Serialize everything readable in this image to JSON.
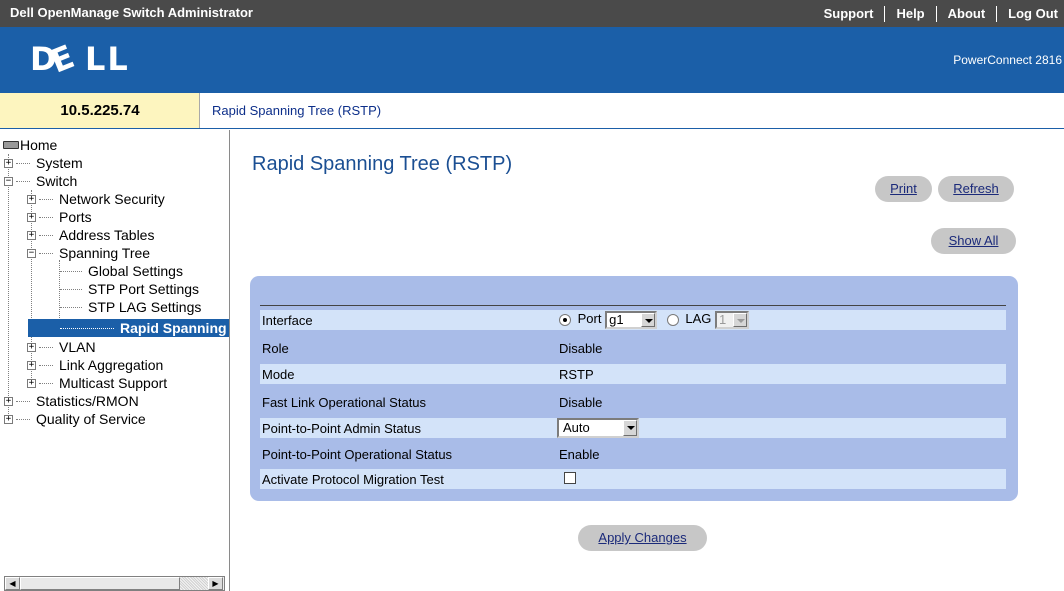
{
  "topbar": {
    "title": "Dell OpenManage Switch Administrator",
    "links": [
      "Support",
      "Help",
      "About",
      "Log Out"
    ]
  },
  "banner": {
    "logo": "DØLL",
    "model": "PowerConnect 2816"
  },
  "address": {
    "ip": "10.5.225.74",
    "breadcrumb": "Rapid Spanning Tree (RSTP)"
  },
  "tree": {
    "home": "Home",
    "system": "System",
    "switch": "Switch",
    "network_security": "Network Security",
    "ports": "Ports",
    "address_tables": "Address Tables",
    "spanning_tree": "Spanning Tree",
    "global_settings": "Global Settings",
    "stp_port_settings": "STP Port Settings",
    "stp_lag_settings": "STP LAG Settings",
    "rapid_spanning": "Rapid Spanning",
    "vlan": "VLAN",
    "link_aggregation": "Link Aggregation",
    "multicast_support": "Multicast Support",
    "statistics_rmon": "Statistics/RMON",
    "quality_of_service": "Quality of Service"
  },
  "main": {
    "title": "Rapid Spanning Tree (RSTP)",
    "print": "Print",
    "refresh": "Refresh",
    "show_all": "Show All",
    "apply": "Apply Changes"
  },
  "form": {
    "interface_label": "Interface",
    "port_label": "Port",
    "port_value": "g1",
    "lag_label": "LAG",
    "lag_value": "1",
    "role_label": "Role",
    "role_value": "Disable",
    "mode_label": "Mode",
    "mode_value": "RSTP",
    "fast_link_label": "Fast Link Operational Status",
    "fast_link_value": "Disable",
    "p2p_admin_label": "Point-to-Point Admin Status",
    "p2p_admin_value": "Auto",
    "p2p_oper_label": "Point-to-Point Operational Status",
    "p2p_oper_value": "Enable",
    "migration_label": "Activate Protocol Migration Test",
    "migration_checked": false
  }
}
